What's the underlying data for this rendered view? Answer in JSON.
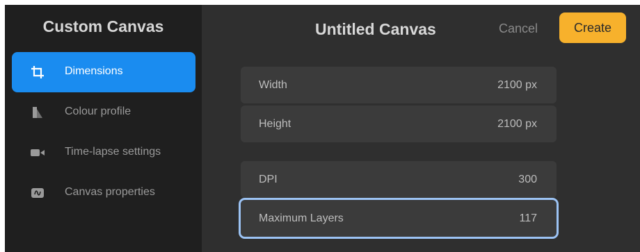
{
  "sidebar": {
    "title": "Custom Canvas",
    "items": [
      {
        "label": "Dimensions",
        "icon": "crop-icon",
        "active": true
      },
      {
        "label": "Colour profile",
        "icon": "colour-profile-icon",
        "active": false
      },
      {
        "label": "Time-lapse settings",
        "icon": "video-camera-icon",
        "active": false
      },
      {
        "label": "Canvas properties",
        "icon": "canvas-properties-icon",
        "active": false
      }
    ]
  },
  "header": {
    "title": "Untitled Canvas",
    "cancel_label": "Cancel",
    "create_label": "Create"
  },
  "fields": [
    {
      "label": "Width",
      "value": "2100 px"
    },
    {
      "label": "Height",
      "value": "2100 px"
    },
    {
      "label": "DPI",
      "value": "300"
    },
    {
      "label": "Maximum Layers",
      "value": "117"
    }
  ],
  "colors": {
    "accent": "#1a8cf0",
    "create_button": "#f7b12c",
    "highlight_outline": "#9cc3f4"
  }
}
